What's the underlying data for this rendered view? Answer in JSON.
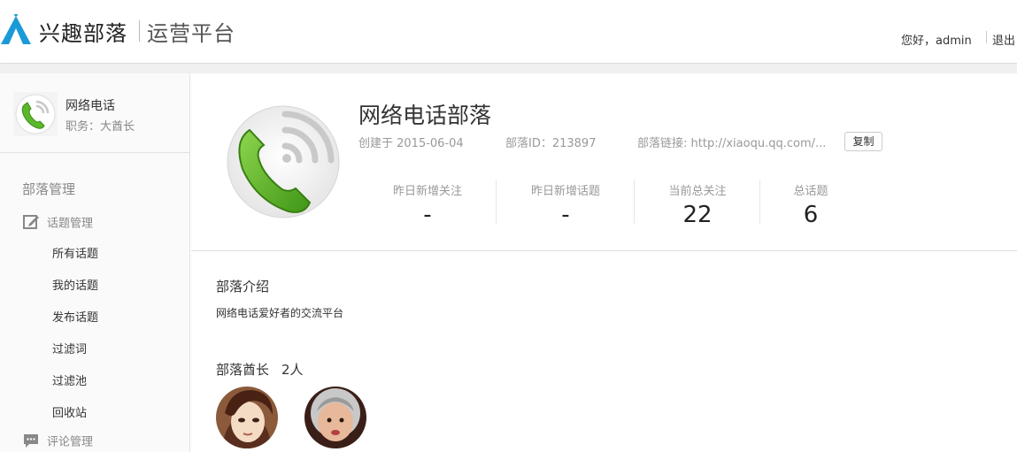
{
  "header": {
    "brand": "兴趣部落",
    "platform": "运营平台",
    "greeting": "您好，admin",
    "logout": "退出",
    "logo_icon": "tent-icon"
  },
  "sidebar": {
    "profile": {
      "name": "网络电话",
      "role": "职务：大酋长"
    },
    "section_title": "部落管理",
    "groups": [
      {
        "label": "话题管理",
        "icon": "edit-icon"
      },
      {
        "label": "评论管理",
        "icon": "comment-icon"
      }
    ],
    "topic_items": [
      "所有话题",
      "我的话题",
      "发布话题",
      "过滤词",
      "过滤池",
      "回收站"
    ]
  },
  "main": {
    "tribe_name": "网络电话部落",
    "created": "创建于 2015-06-04",
    "tribe_id": "部落ID：213897",
    "link_label": "部落链接:",
    "link_value": "http://xiaoqu.qq.com/...",
    "copy_label": "复制",
    "stats": [
      {
        "label": "昨日新增关注",
        "value": "-"
      },
      {
        "label": "昨日新增话题",
        "value": "-"
      },
      {
        "label": "当前总关注",
        "value": "22"
      },
      {
        "label": "总话题",
        "value": "6"
      }
    ],
    "intro_title": "部落介绍",
    "intro_text": "网络电话爱好者的交流平台",
    "chiefs_title": "部落酋长",
    "chiefs_count": "2人"
  },
  "colors": {
    "accent": "#1a9bd7",
    "phone_green": "#5cb82b"
  }
}
